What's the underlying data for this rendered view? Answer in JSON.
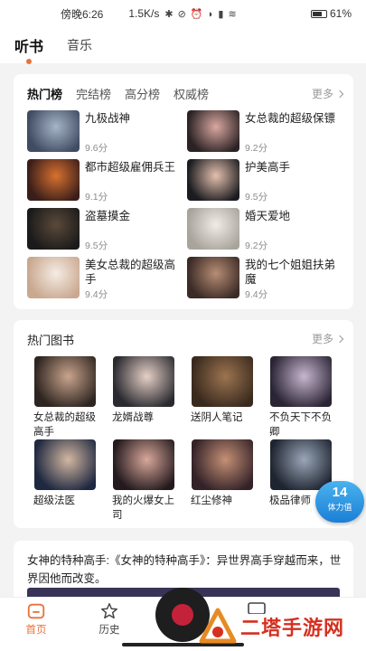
{
  "status_bar": {
    "time": "傍晚6:26",
    "speed": "1.5K/s",
    "icons": "✱ ⊘ ⏰ ◗ ▮ ≋",
    "battery": "61%"
  },
  "top_tabs": [
    {
      "label": "听书",
      "active": true
    },
    {
      "label": "音乐",
      "active": false
    }
  ],
  "rank_section": {
    "tabs": [
      "热门榜",
      "完结榜",
      "高分榜",
      "权威榜"
    ],
    "more": "更多",
    "items": [
      {
        "title": "九极战神",
        "score": "9.6分",
        "color1": "#3f4c62",
        "color2": "#a7b5c8"
      },
      {
        "title": "女总裁的超级保镖",
        "score": "9.2分",
        "color1": "#2b2224",
        "color2": "#d9a8a0"
      },
      {
        "title": "都市超级雇佣兵王",
        "score": "9.1分",
        "color1": "#3a1e1a",
        "color2": "#d8712f"
      },
      {
        "title": "护美高手",
        "score": "9.5分",
        "color1": "#1c1c20",
        "color2": "#e4c0ae"
      },
      {
        "title": "盗墓摸金",
        "score": "9.5分",
        "color1": "#1a1a1a",
        "color2": "#5b4a3a"
      },
      {
        "title": "婚天爱地",
        "score": "9.2分",
        "color1": "#a8a49c",
        "color2": "#f1ece6"
      },
      {
        "title": "美女总裁的超级高手",
        "score": "9.4分",
        "color1": "#c9a890",
        "color2": "#f5ece3"
      },
      {
        "title": "我的七个姐姐扶弟魔",
        "score": "9.4分",
        "color1": "#3b2a26",
        "color2": "#b68d74"
      }
    ]
  },
  "hot_books": {
    "title": "热门图书",
    "more": "更多",
    "items": [
      {
        "title": "女总裁的超级高手",
        "color1": "#2e2520",
        "color2": "#c9a48d"
      },
      {
        "title": "龙婿战尊",
        "color1": "#2a2a30",
        "color2": "#e6d0c6"
      },
      {
        "title": "送阴人笔记",
        "color1": "#3a2a1e",
        "color2": "#9c7450"
      },
      {
        "title": "不负天下不负卿",
        "color1": "#2a2434",
        "color2": "#c8b6cf"
      },
      {
        "title": "超级法医",
        "color1": "#1e2840",
        "color2": "#d3b7a2"
      },
      {
        "title": "我的火爆女上司",
        "color1": "#241a1e",
        "color2": "#d8a79a"
      },
      {
        "title": "红尘修神",
        "color1": "#332228",
        "color2": "#c59076"
      },
      {
        "title": "极品律师",
        "color1": "#1e2430",
        "color2": "#9aa6b8"
      }
    ]
  },
  "feed": {
    "text": "女神的特种高手:《女神的特种高手》：异世界高手穿越而来，世界因他而改变。"
  },
  "float_badge": {
    "number": "14",
    "label": "体力值"
  },
  "tab_bar": {
    "home": "首页",
    "history": "历史"
  },
  "watermark": {
    "text": "二塔手游网"
  },
  "colors": {
    "accent": "#e8733a",
    "badge": "#1c7fd6",
    "watermark": "#d53020"
  }
}
